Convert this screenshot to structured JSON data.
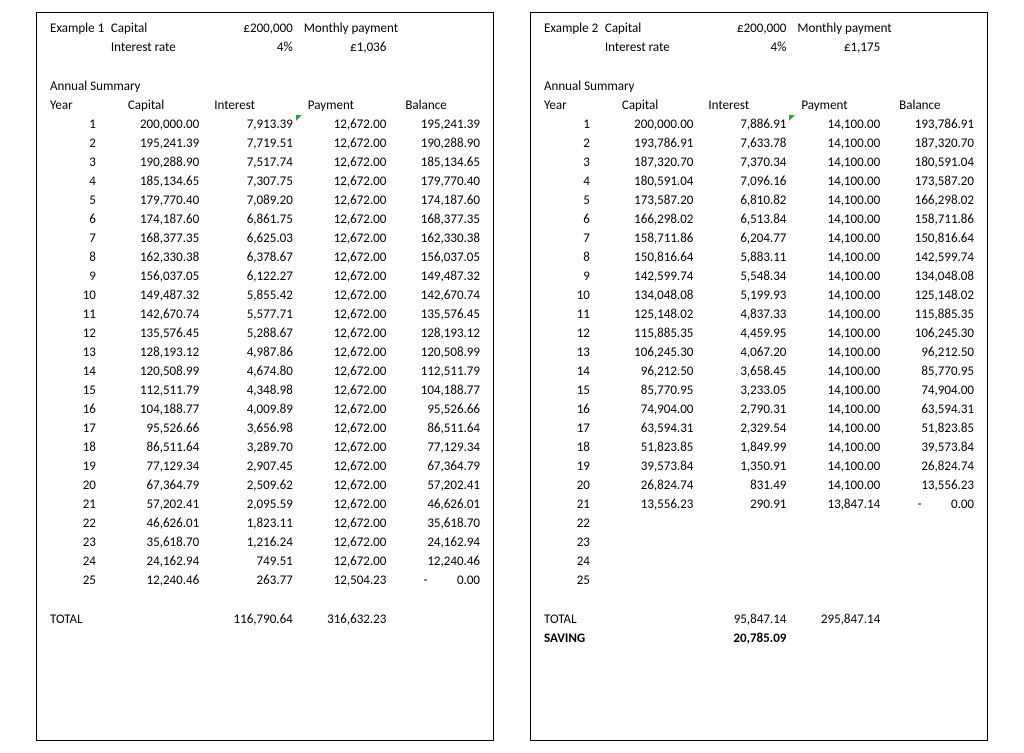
{
  "labels": {
    "example": "Example",
    "capital": "Capital",
    "monthly_payment": "Monthly payment",
    "interest_rate": "Interest rate",
    "annual_summary": "Annual Summary",
    "year": "Year",
    "interest": "Interest",
    "payment": "Payment",
    "balance": "Balance",
    "total": "TOTAL",
    "saving": "SAVING"
  },
  "example1": {
    "number": "1",
    "capital": "£200,000",
    "interest_rate": "4%",
    "monthly_payment": "£1,036",
    "rows": [
      {
        "year": "1",
        "capital": "200,000.00",
        "interest": "7,913.39",
        "payment": "12,672.00",
        "balance": "195,241.39"
      },
      {
        "year": "2",
        "capital": "195,241.39",
        "interest": "7,719.51",
        "payment": "12,672.00",
        "balance": "190,288.90"
      },
      {
        "year": "3",
        "capital": "190,288.90",
        "interest": "7,517.74",
        "payment": "12,672.00",
        "balance": "185,134.65"
      },
      {
        "year": "4",
        "capital": "185,134.65",
        "interest": "7,307.75",
        "payment": "12,672.00",
        "balance": "179,770.40"
      },
      {
        "year": "5",
        "capital": "179,770.40",
        "interest": "7,089.20",
        "payment": "12,672.00",
        "balance": "174,187.60"
      },
      {
        "year": "6",
        "capital": "174,187.60",
        "interest": "6,861.75",
        "payment": "12,672.00",
        "balance": "168,377.35"
      },
      {
        "year": "7",
        "capital": "168,377.35",
        "interest": "6,625.03",
        "payment": "12,672.00",
        "balance": "162,330.38"
      },
      {
        "year": "8",
        "capital": "162,330.38",
        "interest": "6,378.67",
        "payment": "12,672.00",
        "balance": "156,037.05"
      },
      {
        "year": "9",
        "capital": "156,037.05",
        "interest": "6,122.27",
        "payment": "12,672.00",
        "balance": "149,487.32"
      },
      {
        "year": "10",
        "capital": "149,487.32",
        "interest": "5,855.42",
        "payment": "12,672.00",
        "balance": "142,670.74"
      },
      {
        "year": "11",
        "capital": "142,670.74",
        "interest": "5,577.71",
        "payment": "12,672.00",
        "balance": "135,576.45"
      },
      {
        "year": "12",
        "capital": "135,576.45",
        "interest": "5,288.67",
        "payment": "12,672.00",
        "balance": "128,193.12"
      },
      {
        "year": "13",
        "capital": "128,193.12",
        "interest": "4,987.86",
        "payment": "12,672.00",
        "balance": "120,508.99"
      },
      {
        "year": "14",
        "capital": "120,508.99",
        "interest": "4,674.80",
        "payment": "12,672.00",
        "balance": "112,511.79"
      },
      {
        "year": "15",
        "capital": "112,511.79",
        "interest": "4,348.98",
        "payment": "12,672.00",
        "balance": "104,188.77"
      },
      {
        "year": "16",
        "capital": "104,188.77",
        "interest": "4,009.89",
        "payment": "12,672.00",
        "balance": "95,526.66"
      },
      {
        "year": "17",
        "capital": "95,526.66",
        "interest": "3,656.98",
        "payment": "12,672.00",
        "balance": "86,511.64"
      },
      {
        "year": "18",
        "capital": "86,511.64",
        "interest": "3,289.70",
        "payment": "12,672.00",
        "balance": "77,129.34"
      },
      {
        "year": "19",
        "capital": "77,129.34",
        "interest": "2,907.45",
        "payment": "12,672.00",
        "balance": "67,364.79"
      },
      {
        "year": "20",
        "capital": "67,364.79",
        "interest": "2,509.62",
        "payment": "12,672.00",
        "balance": "57,202.41"
      },
      {
        "year": "21",
        "capital": "57,202.41",
        "interest": "2,095.59",
        "payment": "12,672.00",
        "balance": "46,626.01"
      },
      {
        "year": "22",
        "capital": "46,626.01",
        "interest": "1,823.11",
        "payment": "12,672.00",
        "balance": "35,618.70"
      },
      {
        "year": "23",
        "capital": "35,618.70",
        "interest": "1,216.24",
        "payment": "12,672.00",
        "balance": "24,162.94"
      },
      {
        "year": "24",
        "capital": "24,162.94",
        "interest": "749.51",
        "payment": "12,672.00",
        "balance": "12,240.46"
      },
      {
        "year": "25",
        "capital": "12,240.46",
        "interest": "263.77",
        "payment": "12,504.23",
        "balance": "-          0.00"
      }
    ],
    "total_interest": "116,790.64",
    "total_payment": "316,632.23"
  },
  "example2": {
    "number": "2",
    "capital": "£200,000",
    "interest_rate": "4%",
    "monthly_payment": "£1,175",
    "rows": [
      {
        "year": "1",
        "capital": "200,000.00",
        "interest": "7,886.91",
        "payment": "14,100.00",
        "balance": "193,786.91"
      },
      {
        "year": "2",
        "capital": "193,786.91",
        "interest": "7,633.78",
        "payment": "14,100.00",
        "balance": "187,320.70"
      },
      {
        "year": "3",
        "capital": "187,320.70",
        "interest": "7,370.34",
        "payment": "14,100.00",
        "balance": "180,591.04"
      },
      {
        "year": "4",
        "capital": "180,591.04",
        "interest": "7,096.16",
        "payment": "14,100.00",
        "balance": "173,587.20"
      },
      {
        "year": "5",
        "capital": "173,587.20",
        "interest": "6,810.82",
        "payment": "14,100.00",
        "balance": "166,298.02"
      },
      {
        "year": "6",
        "capital": "166,298.02",
        "interest": "6,513.84",
        "payment": "14,100.00",
        "balance": "158,711.86"
      },
      {
        "year": "7",
        "capital": "158,711.86",
        "interest": "6,204.77",
        "payment": "14,100.00",
        "balance": "150,816.64"
      },
      {
        "year": "8",
        "capital": "150,816.64",
        "interest": "5,883.11",
        "payment": "14,100.00",
        "balance": "142,599.74"
      },
      {
        "year": "9",
        "capital": "142,599.74",
        "interest": "5,548.34",
        "payment": "14,100.00",
        "balance": "134,048.08"
      },
      {
        "year": "10",
        "capital": "134,048.08",
        "interest": "5,199.93",
        "payment": "14,100.00",
        "balance": "125,148.02"
      },
      {
        "year": "11",
        "capital": "125,148.02",
        "interest": "4,837.33",
        "payment": "14,100.00",
        "balance": "115,885.35"
      },
      {
        "year": "12",
        "capital": "115,885.35",
        "interest": "4,459.95",
        "payment": "14,100.00",
        "balance": "106,245.30"
      },
      {
        "year": "13",
        "capital": "106,245.30",
        "interest": "4,067.20",
        "payment": "14,100.00",
        "balance": "96,212.50"
      },
      {
        "year": "14",
        "capital": "96,212.50",
        "interest": "3,658.45",
        "payment": "14,100.00",
        "balance": "85,770.95"
      },
      {
        "year": "15",
        "capital": "85,770.95",
        "interest": "3,233.05",
        "payment": "14,100.00",
        "balance": "74,904.00"
      },
      {
        "year": "16",
        "capital": "74,904.00",
        "interest": "2,790.31",
        "payment": "14,100.00",
        "balance": "63,594.31"
      },
      {
        "year": "17",
        "capital": "63,594.31",
        "interest": "2,329.54",
        "payment": "14,100.00",
        "balance": "51,823.85"
      },
      {
        "year": "18",
        "capital": "51,823.85",
        "interest": "1,849.99",
        "payment": "14,100.00",
        "balance": "39,573.84"
      },
      {
        "year": "19",
        "capital": "39,573.84",
        "interest": "1,350.91",
        "payment": "14,100.00",
        "balance": "26,824.74"
      },
      {
        "year": "20",
        "capital": "26,824.74",
        "interest": "831.49",
        "payment": "14,100.00",
        "balance": "13,556.23"
      },
      {
        "year": "21",
        "capital": "13,556.23",
        "interest": "290.91",
        "payment": "13,847.14",
        "balance": "-          0.00"
      },
      {
        "year": "22",
        "capital": "",
        "interest": "",
        "payment": "",
        "balance": ""
      },
      {
        "year": "23",
        "capital": "",
        "interest": "",
        "payment": "",
        "balance": ""
      },
      {
        "year": "24",
        "capital": "",
        "interest": "",
        "payment": "",
        "balance": ""
      },
      {
        "year": "25",
        "capital": "",
        "interest": "",
        "payment": "",
        "balance": ""
      }
    ],
    "total_interest": "95,847.14",
    "total_payment": "295,847.14",
    "saving": "20,785.09"
  }
}
